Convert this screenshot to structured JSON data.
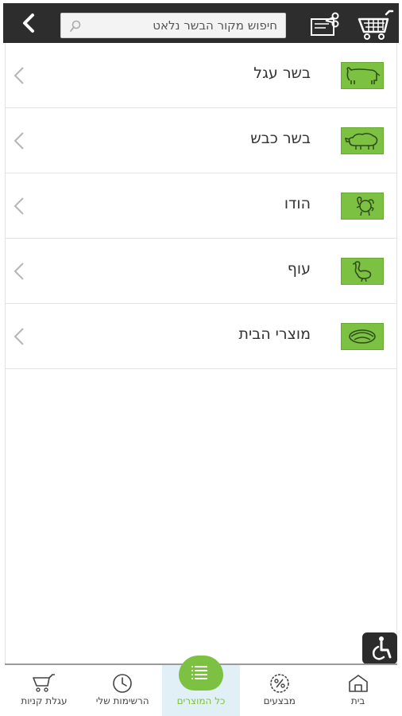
{
  "header": {
    "search_placeholder": "חיפוש מקור הבשר נלאט"
  },
  "categories": [
    {
      "label": "בשר עגל",
      "icon": "cow-icon"
    },
    {
      "label": "בשר כבש",
      "icon": "sheep-icon"
    },
    {
      "label": "הודו",
      "icon": "turkey-icon"
    },
    {
      "label": "עוף",
      "icon": "chicken-icon"
    },
    {
      "label": "מוצרי הבית",
      "icon": "house-products-icon"
    }
  ],
  "tabs": {
    "cart": "עגלת קניות",
    "lists": "הרשימות שלי",
    "all_products": "כל המוצרים",
    "deals": "מבצעים",
    "home": "בית"
  },
  "colors": {
    "accent": "#7dc142",
    "header_bg": "#2d2d2d",
    "active_tab_bg": "#e1f0f6"
  }
}
